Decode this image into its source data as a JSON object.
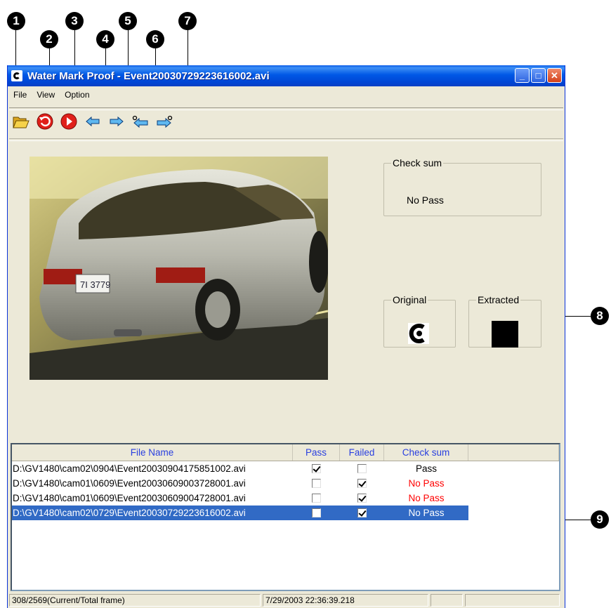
{
  "callouts": [
    "1",
    "2",
    "3",
    "4",
    "5",
    "6",
    "7",
    "8",
    "9"
  ],
  "window": {
    "title": "Water Mark Proof - Event20030729223616002.avi",
    "minimize": "_",
    "maximize": "□",
    "close": "✕"
  },
  "menu": [
    "File",
    "View",
    "Option"
  ],
  "toolbar": [
    {
      "name": "open-folder-icon"
    },
    {
      "name": "rewind-icon"
    },
    {
      "name": "play-icon"
    },
    {
      "name": "previous-frame-icon"
    },
    {
      "name": "next-frame-icon"
    },
    {
      "name": "previous-event-icon"
    },
    {
      "name": "next-event-icon"
    }
  ],
  "checksum": {
    "legend": "Check sum",
    "value": "No Pass"
  },
  "original": {
    "legend": "Original"
  },
  "extracted": {
    "legend": "Extracted"
  },
  "list": {
    "headers": [
      "File Name",
      "Pass",
      "Failed",
      "Check sum"
    ],
    "rows": [
      {
        "file": "D:\\GV1480\\cam02\\0904\\Event20030904175851002.avi",
        "pass": true,
        "failed": false,
        "checksum": "Pass"
      },
      {
        "file": "D:\\GV1480\\cam01\\0609\\Event20030609003728001.avi",
        "pass": false,
        "failed": true,
        "checksum": "No Pass"
      },
      {
        "file": "D:\\GV1480\\cam01\\0609\\Event20030609004728001.avi",
        "pass": false,
        "failed": true,
        "checksum": "No Pass"
      },
      {
        "file": "D:\\GV1480\\cam02\\0729\\Event20030729223616002.avi",
        "pass": false,
        "failed": true,
        "checksum": "No Pass",
        "selected": true
      }
    ]
  },
  "status": {
    "frame": "308/2569(Current/Total frame)",
    "datetime": "7/29/2003 22:36:39.218",
    "empty1": "",
    "empty2": ""
  },
  "colors": {
    "titlebar": "#0058e6",
    "selected_row": "#316ac5",
    "header_text": "#2a40e0",
    "no_pass": "#ff0000"
  }
}
